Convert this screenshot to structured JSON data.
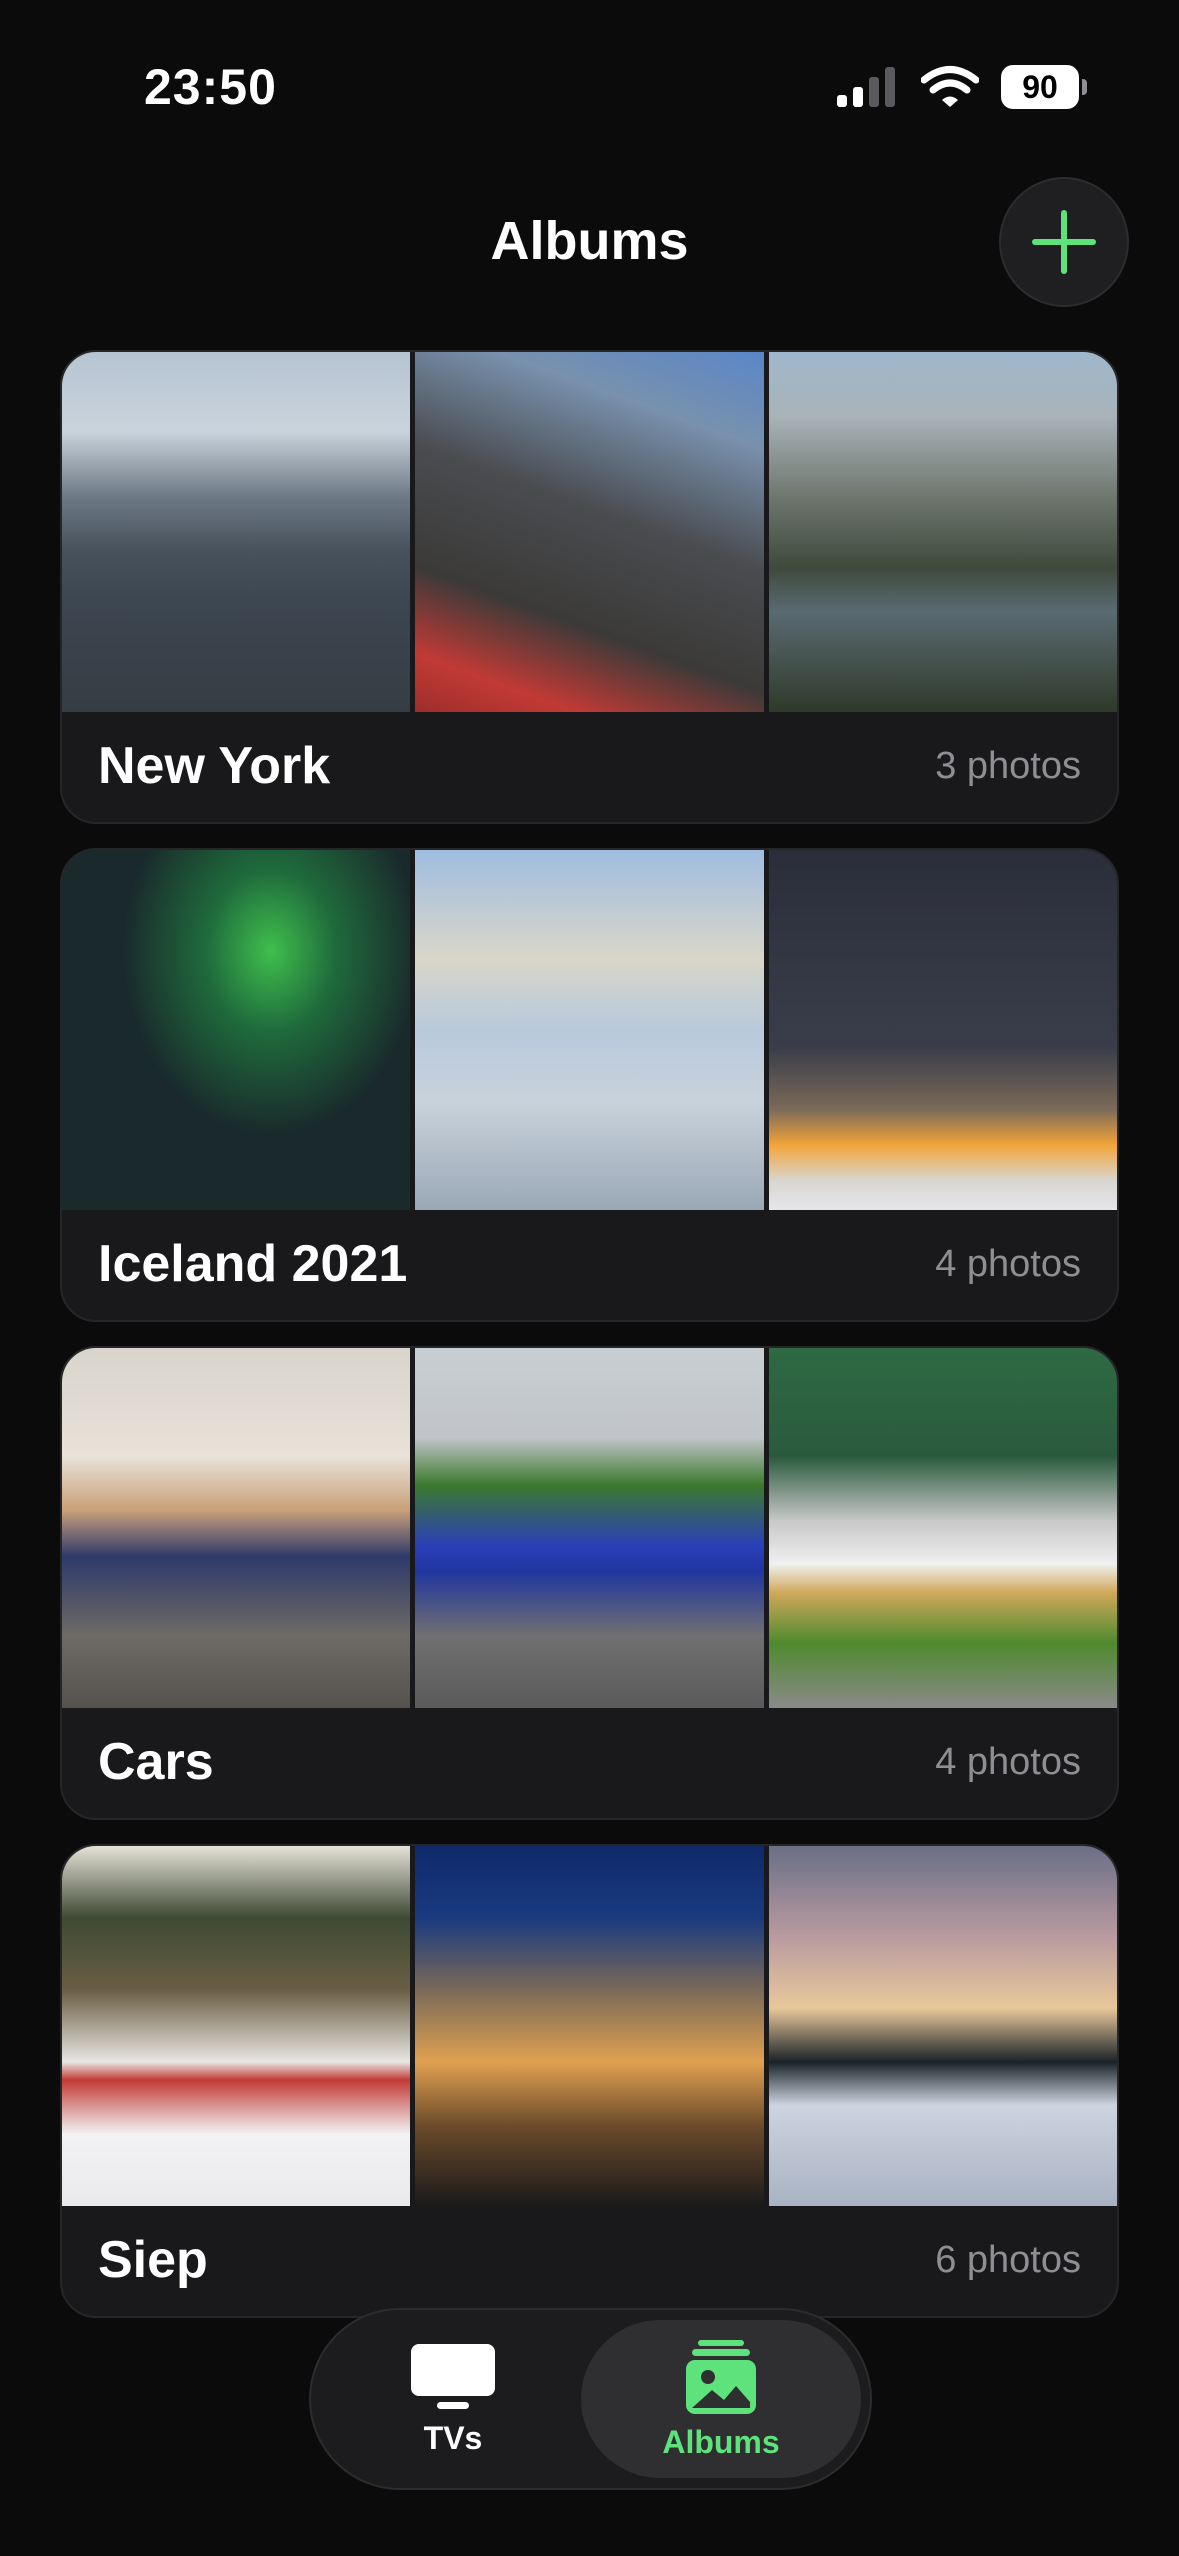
{
  "status_bar": {
    "time": "23:50",
    "battery": "90"
  },
  "header": {
    "title": "Albums",
    "add_icon": "plus-icon",
    "accent_color": "#5ee37c"
  },
  "albums": [
    {
      "name": "New York",
      "count": "3 photos"
    },
    {
      "name": "Iceland 2021",
      "count": "4 photos"
    },
    {
      "name": "Cars",
      "count": "4 photos"
    },
    {
      "name": "Siep",
      "count": "6 photos"
    }
  ],
  "tab_bar": {
    "tabs": [
      {
        "label": "TVs",
        "icon": "tv-icon",
        "selected": false
      },
      {
        "label": "Albums",
        "icon": "photo-album-icon",
        "selected": true
      }
    ]
  }
}
